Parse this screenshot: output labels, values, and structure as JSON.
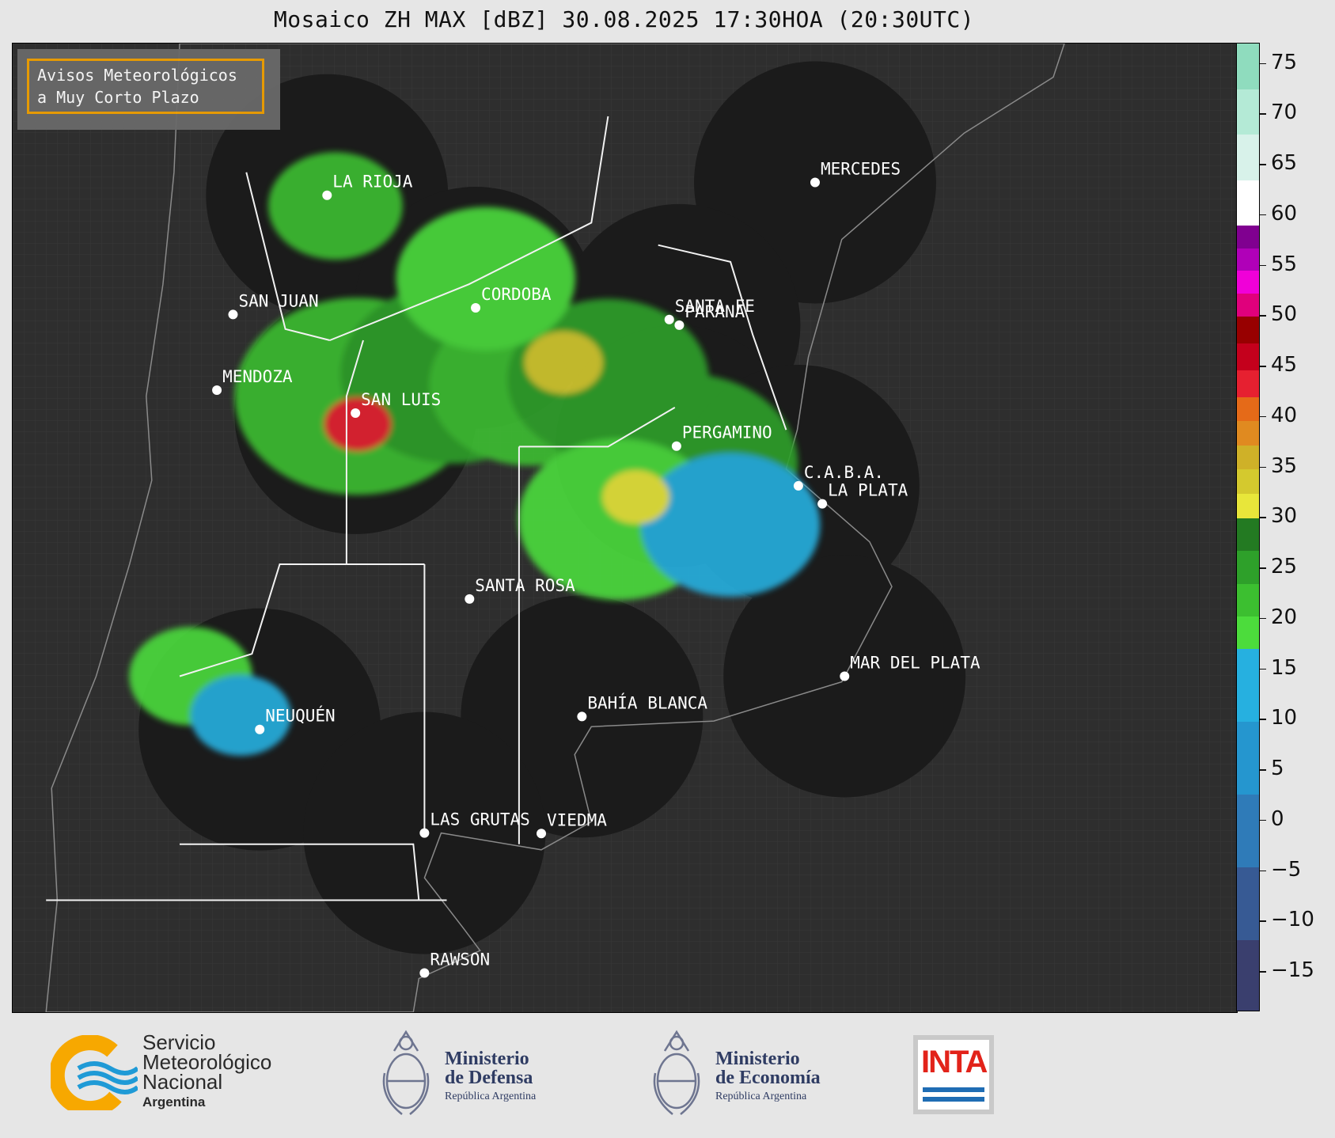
{
  "title": "Mosaico ZH MAX [dBZ] 30.08.2025 17:30HOA (20:30UTC)",
  "legend_box": {
    "line1": "Avisos Meteorológicos",
    "line2": "a Muy Corto Plazo",
    "border_color": "#f0a000"
  },
  "cities": [
    {
      "name": "LA RIOJA",
      "lon": -66.85,
      "lat": -29.41
    },
    {
      "name": "MERCEDES",
      "lon": -58.08,
      "lat": -29.18
    },
    {
      "name": "CORDOBA",
      "lon": -64.18,
      "lat": -31.42
    },
    {
      "name": "SAN JUAN",
      "lon": -68.54,
      "lat": -31.54
    },
    {
      "name": "SANTA FE",
      "lon": -60.7,
      "lat": -31.63
    },
    {
      "name": "PARANA",
      "lon": -60.52,
      "lat": -31.73
    },
    {
      "name": "MENDOZA",
      "lon": -68.83,
      "lat": -32.89
    },
    {
      "name": "SAN LUIS",
      "lon": -66.34,
      "lat": -33.3
    },
    {
      "name": "PERGAMINO",
      "lon": -60.57,
      "lat": -33.89
    },
    {
      "name": "C.A.B.A.",
      "lon": -58.38,
      "lat": -34.6
    },
    {
      "name": "LA PLATA",
      "lon": -57.95,
      "lat": -34.92
    },
    {
      "name": "SANTA ROSA",
      "lon": -64.29,
      "lat": -36.62
    },
    {
      "name": "MAR DEL PLATA",
      "lon": -57.55,
      "lat": -38.0
    },
    {
      "name": "BAHÍA BLANCA",
      "lon": -62.27,
      "lat": -38.72
    },
    {
      "name": "NEUQUÉN",
      "lon": -68.06,
      "lat": -38.95
    },
    {
      "name": "LAS GRUTAS",
      "lon": -65.1,
      "lat": -40.8
    },
    {
      "name": "VIEDMA",
      "lon": -63.0,
      "lat": -40.81
    },
    {
      "name": "RAWSON",
      "lon": -65.1,
      "lat": -43.3
    }
  ],
  "radars": [
    {
      "site": "LA RIOJA",
      "range_km": 240
    },
    {
      "site": "MERCEDES",
      "range_km": 240
    },
    {
      "site": "CORDOBA",
      "range_km": 240
    },
    {
      "site": "PARANA",
      "range_km": 240
    },
    {
      "site": "SAN LUIS",
      "range_km": 240
    },
    {
      "site": "PERGAMINO",
      "range_km": 240
    },
    {
      "site": "C.A.B.A.",
      "range_km": 240
    },
    {
      "site": "MAR DEL PLATA",
      "range_km": 240
    },
    {
      "site": "BAHÍA BLANCA",
      "range_km": 240
    },
    {
      "site": "NEUQUÉN",
      "range_km": 240
    },
    {
      "site": "LAS GRUTAS",
      "range_km": 240
    }
  ],
  "colorbar": {
    "unit": "dBZ",
    "min": -19,
    "max": 77,
    "tick_labels": [
      "75",
      "70",
      "65",
      "60",
      "55",
      "50",
      "45",
      "40",
      "35",
      "30",
      "25",
      "20",
      "15",
      "10",
      "5",
      "0",
      "−5",
      "−10",
      "−15"
    ],
    "tick_values": [
      75,
      70,
      65,
      60,
      55,
      50,
      45,
      40,
      35,
      30,
      25,
      20,
      15,
      10,
      5,
      0,
      -5,
      -10,
      -15
    ],
    "bands": [
      {
        "from": -19,
        "to": 17,
        "colors": [
          "#3a3f6e",
          "#375a94",
          "#2f7bb8",
          "#2596cf",
          "#26b0e0"
        ]
      },
      {
        "from": 17,
        "to": 30,
        "colors": [
          "#4cdc3c",
          "#3cbf30",
          "#2ea02a",
          "#237a22"
        ]
      },
      {
        "from": 30,
        "to": 42,
        "colors": [
          "#e8e63a",
          "#d4c92e",
          "#cfb128",
          "#e08a20",
          "#e56a18"
        ]
      },
      {
        "from": 42,
        "to": 50,
        "colors": [
          "#e62030",
          "#c4001c",
          "#980000"
        ]
      },
      {
        "from": 50,
        "to": 59,
        "colors": [
          "#e0007c",
          "#f000d8",
          "#b000b8",
          "#800090"
        ]
      },
      {
        "from": 59,
        "to": 77,
        "colors": [
          "#ffffff",
          "#d8f2ea",
          "#b4ead6",
          "#8fdcbe"
        ]
      }
    ]
  },
  "reflectivity_cells": [
    {
      "lon": -66.3,
      "lat": -33.0,
      "dbz": 22,
      "r": 2.2
    },
    {
      "lon": -64.6,
      "lat": -32.6,
      "dbz": 24,
      "r": 2.0
    },
    {
      "lon": -63.2,
      "lat": -32.8,
      "dbz": 22,
      "r": 1.8
    },
    {
      "lon": -61.8,
      "lat": -32.7,
      "dbz": 25,
      "r": 1.8
    },
    {
      "lon": -60.4,
      "lat": -34.2,
      "dbz": 26,
      "r": 2.0
    },
    {
      "lon": -61.6,
      "lat": -35.2,
      "dbz": 20,
      "r": 1.8
    },
    {
      "lon": -59.6,
      "lat": -35.3,
      "dbz": 14,
      "r": 1.6
    },
    {
      "lon": -64.0,
      "lat": -30.9,
      "dbz": 18,
      "r": 1.6
    },
    {
      "lon": -66.7,
      "lat": -29.6,
      "dbz": 22,
      "r": 1.2
    },
    {
      "lon": -66.3,
      "lat": -33.5,
      "dbz": 42,
      "r": 0.6
    },
    {
      "lon": -62.6,
      "lat": -32.4,
      "dbz": 33,
      "r": 0.7
    },
    {
      "lon": -61.3,
      "lat": -34.8,
      "dbz": 32,
      "r": 0.6
    },
    {
      "lon": -69.3,
      "lat": -38.0,
      "dbz": 20,
      "r": 1.1
    },
    {
      "lon": -68.4,
      "lat": -38.7,
      "dbz": 12,
      "r": 0.9
    }
  ],
  "footer": {
    "smn": {
      "line1": "Servicio",
      "line2": "Meteorológico",
      "line3": "Nacional",
      "line4": "Argentina"
    },
    "defensa": {
      "line1": "Ministerio",
      "line2": "de Defensa",
      "line3": "República Argentina"
    },
    "economia": {
      "line1": "Ministerio",
      "line2": "de Economía",
      "line3": "República Argentina"
    },
    "inta": "INTA"
  }
}
